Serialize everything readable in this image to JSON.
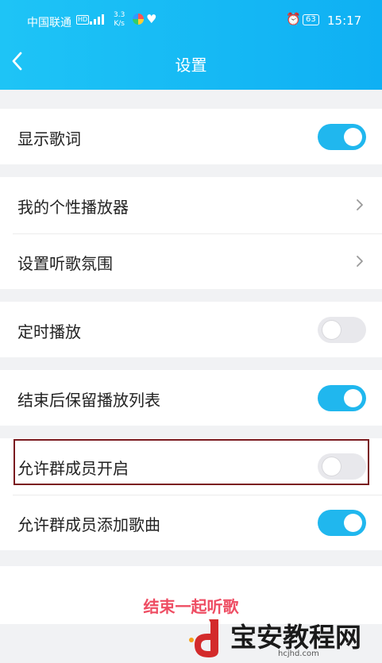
{
  "status_bar": {
    "carrier": "中国联通",
    "hd": "HD",
    "speed_value": "3.3",
    "speed_unit": "K/s",
    "battery": "63",
    "time": "15:17"
  },
  "header": {
    "title": "设置"
  },
  "settings": {
    "show_lyrics": {
      "label": "显示歌词",
      "enabled": true
    },
    "my_player": {
      "label": "我的个性播放器"
    },
    "listening_atmosphere": {
      "label": "设置听歌氛围"
    },
    "timed_play": {
      "label": "定时播放",
      "enabled": false
    },
    "keep_playlist": {
      "label": "结束后保留播放列表",
      "enabled": true
    },
    "allow_members_start": {
      "label": "允许群成员开启",
      "enabled": false
    },
    "allow_members_add": {
      "label": "允许群成员添加歌曲",
      "enabled": true
    }
  },
  "end_button": {
    "label": "结束一起听歌"
  },
  "watermark": {
    "text": "宝安教程网",
    "url": "hcjhd.com"
  },
  "colors": {
    "header": "#14b8f4",
    "toggle_on": "#20b7ee",
    "toggle_off": "#e8e8ec",
    "end_button": "#ee4d63",
    "highlight_border": "#7a1a1f"
  }
}
